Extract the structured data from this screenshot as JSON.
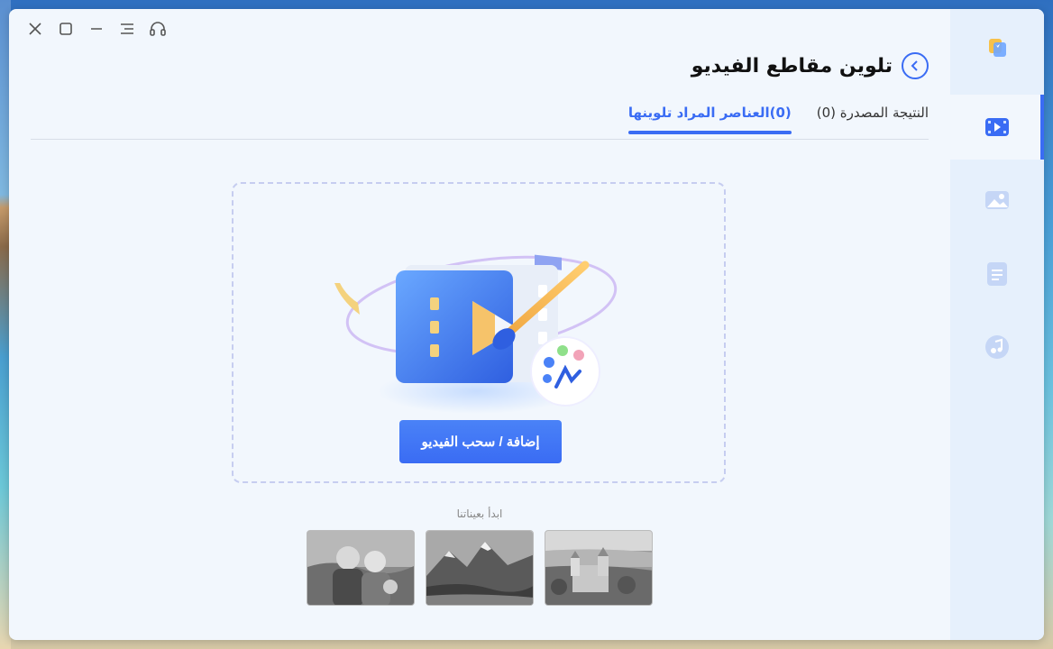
{
  "window": {
    "controls": [
      "close-icon",
      "maximize-icon",
      "minimize-icon",
      "menu-icon",
      "headset-icon"
    ]
  },
  "header": {
    "title": "تلوين مقاطع الفيديو"
  },
  "tabs": [
    {
      "label": "النتيجة المصدرة (0)",
      "active": false
    },
    {
      "label": "(0)العناصر المراد تلوينها",
      "active": true
    }
  ],
  "dropzone": {
    "button_label": "إضافة / سحب الفيديو"
  },
  "samples": {
    "label": "ابدأ بعيناتنا",
    "items": [
      "sample-couple",
      "sample-mountains",
      "sample-castle"
    ]
  },
  "sidebar": {
    "items": [
      {
        "icon": "toolbox-icon",
        "active": false
      },
      {
        "icon": "video-icon",
        "active": true
      },
      {
        "icon": "image-icon",
        "active": false
      },
      {
        "icon": "document-icon",
        "active": false
      },
      {
        "icon": "music-icon",
        "active": false
      }
    ]
  },
  "colors": {
    "accent": "#3a6cf4",
    "window_bg": "#f2f7fd",
    "sidebar_bg": "#e6f0fc"
  }
}
